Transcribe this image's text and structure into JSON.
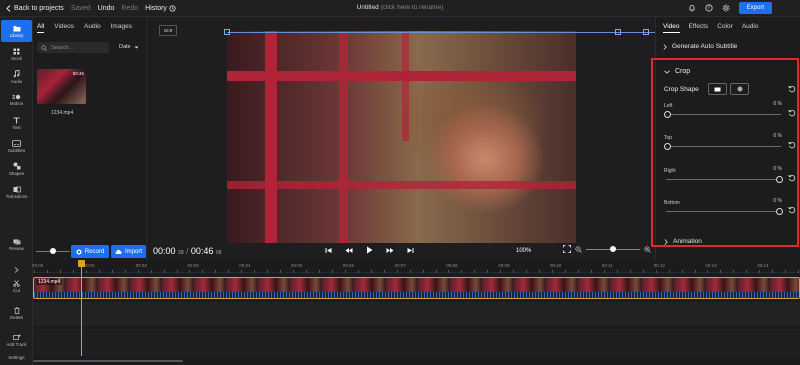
{
  "topbar": {
    "back_label": "Back to projects",
    "saved": "Saved",
    "undo": "Undo",
    "redo": "Redo",
    "history": "History",
    "project_title": "Untitled",
    "rename_hint": "(click here to rename)",
    "export_label": "Export"
  },
  "nav": {
    "items": [
      {
        "label": "Library",
        "icon": "folder-icon"
      },
      {
        "label": "Stock",
        "icon": "grid-icon"
      },
      {
        "label": "Audio",
        "icon": "music-icon"
      },
      {
        "label": "Motion",
        "icon": "motion-icon"
      },
      {
        "label": "Text",
        "icon": "text-icon"
      },
      {
        "label": "Subtitles",
        "icon": "subtitles-icon"
      },
      {
        "label": "Shapes",
        "icon": "shapes-icon"
      },
      {
        "label": "Transitions",
        "icon": "transitions-icon"
      }
    ],
    "timeline_tools": [
      {
        "label": "Cut"
      },
      {
        "label": "Delete"
      },
      {
        "label": "Add Track"
      },
      {
        "label": "Settings"
      }
    ],
    "review_label": "Review"
  },
  "library": {
    "tabs": [
      "All",
      "Videos",
      "Audio",
      "Images"
    ],
    "search_placeholder": "Search...",
    "sort_label": "Date",
    "media": [
      {
        "name": "1234.mp4",
        "duration": "00:46"
      }
    ]
  },
  "preview": {
    "aspect_ratio": "16:9"
  },
  "controls": {
    "record_label": "Record",
    "import_label": "Import",
    "current_time": "00:00",
    "current_frames": "28",
    "total_time": "00:46",
    "total_frames": "08",
    "zoom": "100%"
  },
  "right_panel": {
    "tabs": [
      "Video",
      "Effects",
      "Color",
      "Audio"
    ],
    "generate_subtitle": "Generate Auto Subtitle",
    "crop": {
      "title": "Crop",
      "shape_label": "Crop Shape",
      "sliders": [
        {
          "label": "Left",
          "value": "0 %",
          "level": 0
        },
        {
          "label": "Top",
          "value": "0 %",
          "level": 0
        },
        {
          "label": "Right",
          "value": "0 %",
          "level": 1
        },
        {
          "label": "Bottom",
          "value": "0 %",
          "level": 1
        }
      ]
    },
    "animation_label": "Animation"
  },
  "timeline": {
    "ticks": [
      "00:00",
      "00:01",
      "00:02",
      "00:03",
      "00:04",
      "00:05",
      "00:06",
      "00:07",
      "00:08",
      "00:09",
      "00:10",
      "00:11",
      "00:12",
      "00:13",
      "00:14"
    ],
    "clip_name": "1234.mp4"
  },
  "colors": {
    "accent": "#1e6ff0",
    "highlight": "#e0282e",
    "playhead": "#e0a020"
  }
}
